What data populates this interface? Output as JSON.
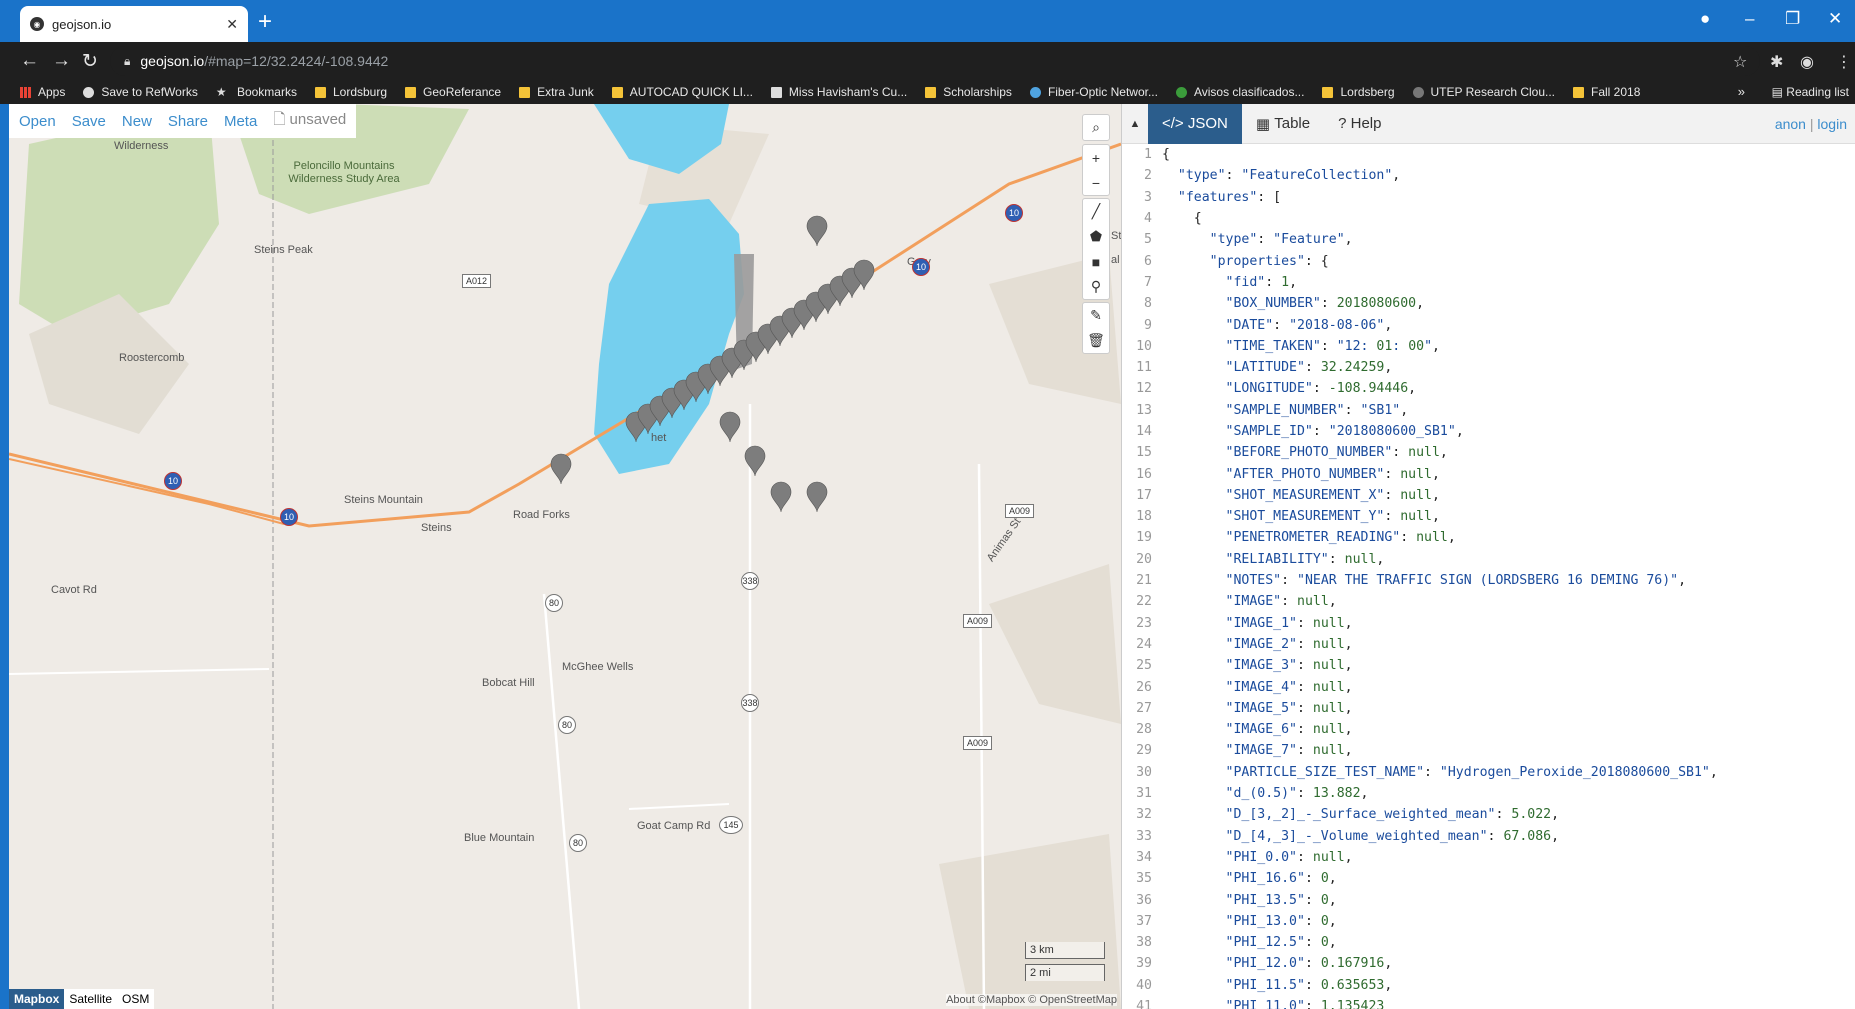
{
  "browser": {
    "tab_title": "geojson.io",
    "url_host": "geojson.io",
    "url_path": "/#map=12/32.2424/-108.9442",
    "bookmarks": [
      "Apps",
      "Save to RefWorks",
      "Bookmarks",
      "Lordsburg",
      "GeoReferance",
      "Extra Junk",
      "AUTOCAD QUICK LI...",
      "Miss Havisham's Cu...",
      "Scholarships",
      "Fiber-Optic Networ...",
      "Avisos clasificados...",
      "Lordsberg",
      "UTEP Research Clou...",
      "Fall 2018"
    ],
    "reading_list": "Reading list"
  },
  "menu": {
    "open": "Open",
    "save": "Save",
    "new": "New",
    "share": "Share",
    "meta": "Meta",
    "status": "unsaved"
  },
  "map": {
    "labels": {
      "wilderness": "Wilderness",
      "peloncillo": "Peloncillo Mountains Wilderness Study Area",
      "steins_peak": "Steins Peak",
      "roostercomb": "Roostercomb",
      "gary": "Gary",
      "steins_mountain": "Steins Mountain",
      "steins": "Steins",
      "road_forks": "Road Forks",
      "cavot_rd": "Cavot Rd",
      "mcghee_wells": "McGhee Wells",
      "bobcat_hill": "Bobcat Hill",
      "blue_mountain": "Blue Mountain",
      "goat_camp_rd": "Goat Camp Rd",
      "animas_st": "Animas St",
      "partial_st": "St",
      "partial_al": "al",
      "partial_het": "het"
    },
    "shields": {
      "i10": "10",
      "r338": "338",
      "r80": "80",
      "r145": "145",
      "a012": "A012",
      "a009": "A009"
    },
    "scale_km": "3 km",
    "scale_mi": "2 mi",
    "layers": [
      "Mapbox",
      "Satellite",
      "OSM"
    ],
    "attribution": "About  ©Mapbox © OpenStreetMap"
  },
  "panel": {
    "tabs": [
      "JSON",
      "Table",
      "Help"
    ],
    "anon": "anon",
    "login": "login"
  },
  "json_lines": [
    "{",
    "  \"type\": \"FeatureCollection\",",
    "  \"features\": [",
    "    {",
    "      \"type\": \"Feature\",",
    "      \"properties\": {",
    "        \"fid\": 1,",
    "        \"BOX_NUMBER\": 2018080600,",
    "        \"DATE\": \"2018-08-06\",",
    "        \"TIME_TAKEN\": \"12:01:00\",",
    "        \"LATITUDE\": 32.24259,",
    "        \"LONGITUDE\": -108.94446,",
    "        \"SAMPLE_NUMBER\": \"SB1\",",
    "        \"SAMPLE_ID\": \"2018080600_SB1\",",
    "        \"BEFORE_PHOTO_NUMBER\": null,",
    "        \"AFTER_PHOTO_NUMBER\": null,",
    "        \"SHOT_MEASUREMENT_X\": null,",
    "        \"SHOT_MEASUREMENT_Y\": null,",
    "        \"PENETROMETER_READING\": null,",
    "        \"RELIABILITY\": null,",
    "        \"NOTES\": \"NEAR THE TRAFFIC SIGN (LORDSBERG 16 DEMING 76)\",",
    "        \"IMAGE\": null,",
    "        \"IMAGE_1\": null,",
    "        \"IMAGE_2\": null,",
    "        \"IMAGE_3\": null,",
    "        \"IMAGE_4\": null,",
    "        \"IMAGE_5\": null,",
    "        \"IMAGE_6\": null,",
    "        \"IMAGE_7\": null,",
    "        \"PARTICLE_SIZE_TEST_NAME\": \"Hydrogen_Peroxide_2018080600_SB1\",",
    "        \"d_(0.5)\": 13.882,",
    "        \"D_[3,_2]_-_Surface_weighted_mean\": 5.022,",
    "        \"D_[4,_3]_-_Volume_weighted_mean\": 67.086,",
    "        \"PHI_0.0\": null,",
    "        \"PHI_16.6\": 0,",
    "        \"PHI_13.5\": 0,",
    "        \"PHI_13.0\": 0,",
    "        \"PHI_12.5\": 0,",
    "        \"PHI_12.0\": 0.167916,",
    "        \"PHI_11.5\": 0.635653,",
    "        \"PHI_11.0\": 1.135423"
  ]
}
